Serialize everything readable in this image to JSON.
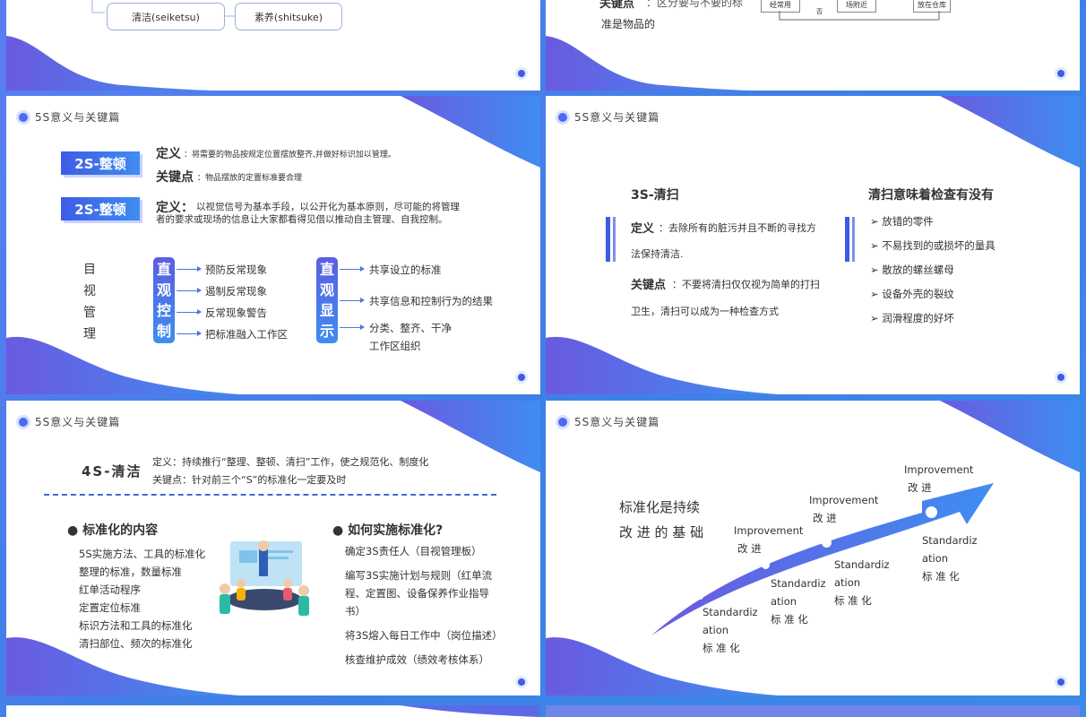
{
  "header": "5S意义与关键篇",
  "slide1": {
    "pill_left": "清洁(seiketsu)",
    "pill_right": "素养(shitsuke)"
  },
  "slide2": {
    "key_label": "关键点",
    "key_fragment": "：区分要与不要的标",
    "key_line2": "准是物品的",
    "flow_boxes": [
      "经常用",
      "场附近",
      "放在仓库"
    ],
    "flow_no": "否"
  },
  "slide3": {
    "badge1": "2S-整顿",
    "def_label": "定义",
    "def1": "：将需要的物品按规定位置摆放整齐,并做好标识加以管理。",
    "key_label": "关键点",
    "key1": "：物品摆放的定置标准要合理",
    "badge2": "2S-整顿",
    "def2_label": "定义：",
    "def2_line1": "以视觉信号为基本手段，以公开化为基本原则，尽可能的将管理",
    "def2_line2": "者的要求或现场的信息让大家都看得见借以推动自主管理、自我控制。",
    "side_chars": [
      "目",
      "视",
      "管",
      "理"
    ],
    "ctrl_chars": [
      "直",
      "观",
      "控",
      "制"
    ],
    "ctrl_items": [
      "预防反常现象",
      "遏制反常现象",
      "反常现象警告",
      "把标准融入工作区"
    ],
    "disp_chars": [
      "直",
      "观",
      "显",
      "示"
    ],
    "disp_items": [
      "共享设立的标准",
      "共享信息和控制行为的结果",
      "分类、整齐、干净",
      "工作区组织"
    ]
  },
  "slide4": {
    "title": "3S-清扫",
    "def_label": "定义",
    "def_line1": "：去除所有的脏污并且不断的寻找方",
    "def_line2": "法保持清洁.",
    "key_label": "关键点",
    "key_line1": "：不要将清扫仅仅视为简单的打扫",
    "key_line2": "卫生，清扫可以成为一种检查方式",
    "right_title": "清扫意味着检查有没有",
    "right_items": [
      "放错的零件",
      "不易找到的或损坏的量具",
      "散放的螺丝螺母",
      "设备外壳的裂纹",
      "润滑程度的好坏"
    ]
  },
  "slide5": {
    "title": "4S-清洁",
    "def": "定义：持续推行“整理、整顿、清扫”工作，使之规范化、制度化",
    "key": "关键点：针对前三个“S”的标准化一定要及时",
    "left_title": "标准化的内容",
    "left_items": [
      "5S实施方法、工具的标准化",
      "整理的标准，数量标准",
      "红单活动程序",
      "定置定位标准",
      "标识方法和工具的标准化",
      "清扫部位、频次的标准化"
    ],
    "right_title": "如何实施标准化?",
    "right_items": [
      "确定3S责任人（目视管理板）",
      "编写3S实施计划与规则（红单流",
      "程、定置图、设备保养作业指导",
      "书）",
      "将3S熔入每日工作中（岗位描述）",
      "核查维护成效（绩效考核体系）"
    ]
  },
  "slide6": {
    "title_line1": "标准化是持续",
    "title_line2": "改 进 的 基 础",
    "improvement": "Improvement",
    "improve_cn": "改 进",
    "standard1": "Standardiz",
    "standard2": "ation",
    "standard_cn": "标 准 化"
  },
  "colors": {
    "accent": "#3d5ce6",
    "accent2": "#3f8df0",
    "frame": "#3b7fe6"
  }
}
